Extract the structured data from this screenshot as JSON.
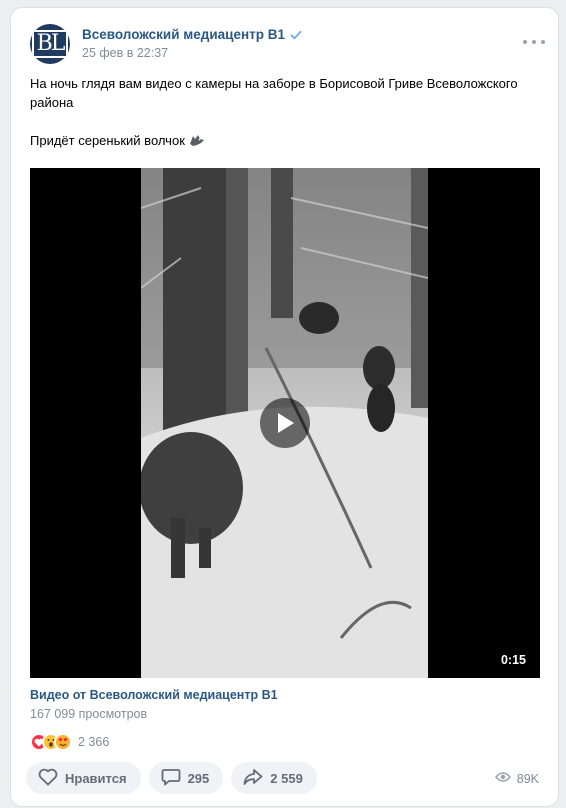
{
  "post": {
    "author": "Всеволожский медиацентр В1",
    "date": "25 фев в 22:37",
    "text_line1": "На ночь глядя вам видео с камеры на заборе в Борисовой Гриве Всеволожского района",
    "text_line2": "Придёт серенький волчок",
    "text_emoji": "wolf-icon"
  },
  "video": {
    "duration": "0:15",
    "title": "Видео от Всеволожский медиацентр В1",
    "views": "167 099 просмотров"
  },
  "reactions": {
    "icons": [
      "heart-icon",
      "wow-icon",
      "love-face-icon"
    ],
    "count": "2 366"
  },
  "actions": {
    "like_label": "Нравится",
    "comments_count": "295",
    "shares_count": "2 559"
  },
  "stats": {
    "views": "89K"
  },
  "colors": {
    "link": "#2a5885",
    "muted": "#818c99",
    "button_bg": "#f0f2f5",
    "avatar_bg": "#1f3b5f"
  }
}
